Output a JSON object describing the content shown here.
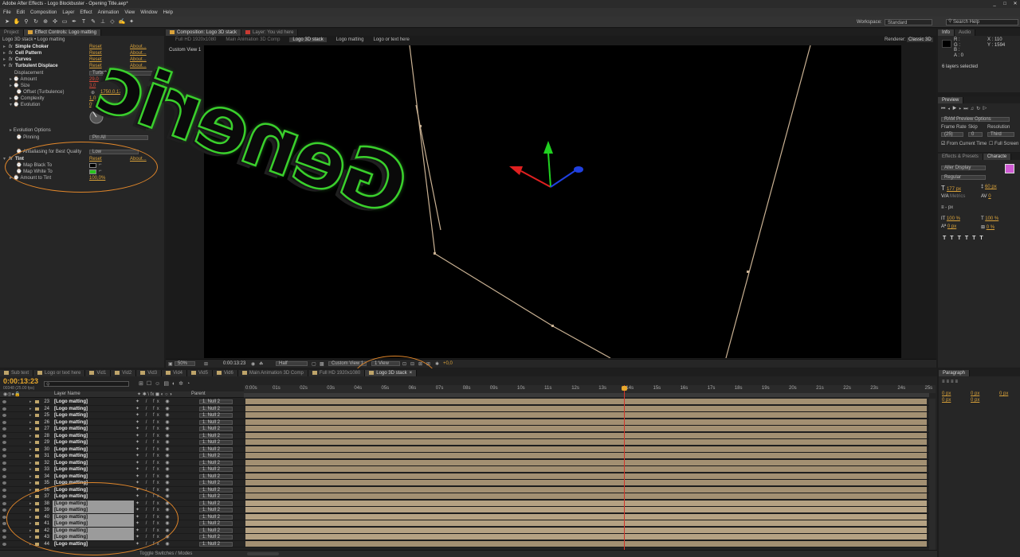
{
  "app": {
    "title": "Adobe After Effects - Logo Blockbuster - Opening Title.aep*",
    "menu": [
      "File",
      "Edit",
      "Composition",
      "Layer",
      "Effect",
      "Animation",
      "View",
      "Window",
      "Help"
    ],
    "window_controls": [
      "_",
      "□",
      "✕"
    ]
  },
  "toolbar": {
    "workspace_label": "Workspace:",
    "workspace_value": "Standard",
    "search_placeholder": "Search Help"
  },
  "effect_controls": {
    "tabs": [
      "Project",
      "Effect Controls: Logo matting"
    ],
    "header": "Logo 3D stack • Logo matting",
    "effects": [
      {
        "name": "Simple Choker",
        "reset": "Reset",
        "about": "About..."
      },
      {
        "name": "Cell Pattern",
        "reset": "Reset",
        "about": "About..."
      },
      {
        "name": "Curves",
        "reset": "Reset",
        "about": "About..."
      },
      {
        "name": "Turbulent Displace",
        "reset": "Reset",
        "about": "About..."
      }
    ],
    "props": {
      "displacement_label": "Displacement",
      "displacement_value": "Turbulent",
      "amount_label": "Amount",
      "amount_value": "29,0",
      "size_label": "Size",
      "size_value": "3,0",
      "offset_label": "Offset (Turbulence)",
      "offset_value": "1750,0,1750,0",
      "complexity_label": "Complexity",
      "complexity_value": "1,0",
      "evolution_label": "Evolution",
      "evolution_value": "0x+34,0°",
      "evolution_options": "Evolution Options",
      "pinning_label": "Pinning",
      "pinning_value": "Pin All",
      "antialias_label": "Antialiasing for Best Quality",
      "antialias_value": "Low"
    },
    "tint": {
      "name": "Tint",
      "reset": "Reset",
      "about": "About...",
      "black_label": "Map Black To",
      "white_label": "Map White To",
      "amount_label": "Amount to Tint",
      "amount_value": "100,0%",
      "black_color": "#000000",
      "white_color": "#29c41e"
    }
  },
  "composition": {
    "tabs": [
      "Composition: Logo 3D stack",
      "Layer: You vid here"
    ],
    "subtabs": [
      "Full HD 1920x1080",
      "Main Animation 3D Comp",
      "Logo 3D stack",
      "Logo matting",
      "Logo or text here"
    ],
    "renderer_label": "Renderer:",
    "renderer_value": "Classic 3D",
    "view_label": "Custom View 1",
    "viewer_text": "Generic",
    "footer": {
      "zoom": "50%",
      "timecode": "0:00:13:23",
      "resolution": "Half",
      "view": "Custom View 1",
      "views": "1 View",
      "exposure": "+0,0"
    }
  },
  "info": {
    "tabs": [
      "Info",
      "Audio"
    ],
    "r": "R :",
    "g": "G :",
    "b": "B :",
    "a": "A : 0",
    "x": "X : 110",
    "y": "Y : 1594",
    "selected": "6 layers selected"
  },
  "preview": {
    "tab": "Preview",
    "ram": "RAM Preview Options",
    "fps_label": "Frame Rate",
    "skip_label": "Skip",
    "res_label": "Resolution",
    "fps": "(25)",
    "skip": "0",
    "res": "Third",
    "from_current": "From Current Time",
    "full_screen": "Full Screen"
  },
  "character": {
    "tabs": [
      "Effects & Presets",
      "Characte"
    ],
    "font": "Aller Display",
    "style": "Regular",
    "size": "177 px",
    "leading": "60 px",
    "kerning": "Metrics",
    "tracking": "0",
    "stroke": "- px",
    "scale_v": "100 %",
    "scale_h": "100 %",
    "baseline": "0 px",
    "tsume": "0 %",
    "fill_color": "#d05ad4"
  },
  "timeline": {
    "tabs": [
      "Sub text",
      "Logo or text here",
      "Vid1",
      "Vid2",
      "Vid3",
      "Vid4",
      "Vid5",
      "Vid6",
      "Main Animation 3D Comp",
      "Full HD 1920x1080",
      "Logo 3D stack"
    ],
    "timecode": "0:00:13:23",
    "fps_info": "00348 (25.00 fps)",
    "col_layer": "Layer Name",
    "col_parent": "Parent",
    "ruler": [
      "0:00s",
      "01s",
      "02s",
      "03s",
      "04s",
      "05s",
      "06s",
      "07s",
      "08s",
      "09s",
      "10s",
      "11s",
      "12s",
      "13s",
      "14s",
      "15s",
      "16s",
      "17s",
      "18s",
      "19s",
      "20s",
      "21s",
      "22s",
      "23s",
      "24s",
      "25s"
    ],
    "layers": [
      {
        "num": "23",
        "name": "[Logo matting]",
        "parent": "1. Null 2",
        "sel": false
      },
      {
        "num": "24",
        "name": "[Logo matting]",
        "parent": "1. Null 2",
        "sel": false
      },
      {
        "num": "25",
        "name": "[Logo matting]",
        "parent": "1. Null 2",
        "sel": false
      },
      {
        "num": "26",
        "name": "[Logo matting]",
        "parent": "1. Null 2",
        "sel": false
      },
      {
        "num": "27",
        "name": "[Logo matting]",
        "parent": "1. Null 2",
        "sel": false
      },
      {
        "num": "28",
        "name": "[Logo matting]",
        "parent": "1. Null 2",
        "sel": false
      },
      {
        "num": "29",
        "name": "[Logo matting]",
        "parent": "1. Null 2",
        "sel": false
      },
      {
        "num": "30",
        "name": "[Logo matting]",
        "parent": "1. Null 2",
        "sel": false
      },
      {
        "num": "31",
        "name": "[Logo matting]",
        "parent": "1. Null 2",
        "sel": false
      },
      {
        "num": "32",
        "name": "[Logo matting]",
        "parent": "1. Null 2",
        "sel": false
      },
      {
        "num": "33",
        "name": "[Logo matting]",
        "parent": "1. Null 2",
        "sel": false
      },
      {
        "num": "34",
        "name": "[Logo matting]",
        "parent": "1. Null 2",
        "sel": false
      },
      {
        "num": "35",
        "name": "[Logo matting]",
        "parent": "1. Null 2",
        "sel": false
      },
      {
        "num": "36",
        "name": "[Logo matting]",
        "parent": "1. Null 2",
        "sel": false
      },
      {
        "num": "37",
        "name": "[Logo matting]",
        "parent": "1. Null 2",
        "sel": false
      },
      {
        "num": "38",
        "name": "[Logo matting]",
        "parent": "1. Null 2",
        "sel": true
      },
      {
        "num": "39",
        "name": "[Logo matting]",
        "parent": "1. Null 2",
        "sel": true
      },
      {
        "num": "40",
        "name": "[Logo matting]",
        "parent": "1. Null 2",
        "sel": true
      },
      {
        "num": "41",
        "name": "[Logo matting]",
        "parent": "1. Null 2",
        "sel": true
      },
      {
        "num": "42",
        "name": "[Logo matting]",
        "parent": "1. Null 2",
        "sel": true
      },
      {
        "num": "43",
        "name": "[Logo matting]",
        "parent": "1. Null 2",
        "sel": true
      },
      {
        "num": "44",
        "name": "[Logo matting]",
        "parent": "1. Null 2",
        "sel": false
      }
    ],
    "toggle_label": "Toggle Switches / Modes"
  },
  "paragraph": {
    "tab": "Paragraph",
    "v1": "0 px",
    "v2": "0 px",
    "v3": "0 px",
    "v4": "0 px",
    "v5": "0 px"
  }
}
